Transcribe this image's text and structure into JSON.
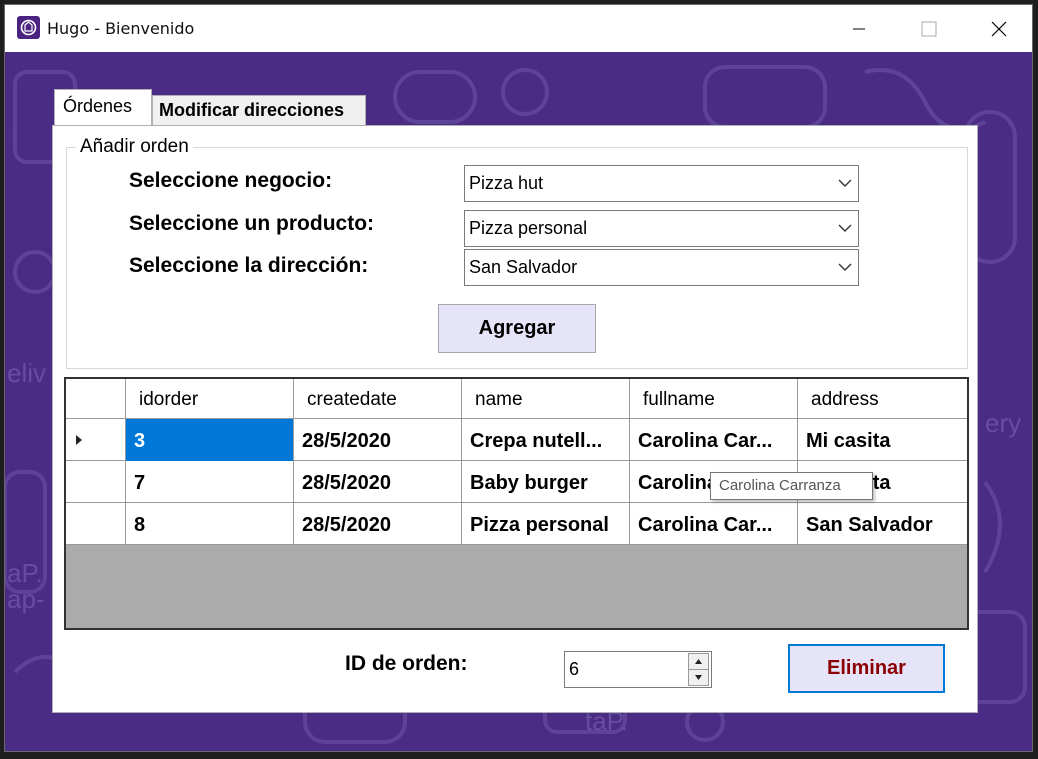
{
  "window": {
    "title": "Hugo - Bienvenido"
  },
  "tabs": [
    {
      "label": "Órdenes",
      "active": true
    },
    {
      "label": "Modificar direcciones",
      "active": false
    }
  ],
  "add_order": {
    "group_label": "Añadir orden",
    "business_label": "Seleccione negocio:",
    "business_value": "Pizza hut",
    "product_label": "Seleccione un producto:",
    "product_value": "Pizza personal",
    "address_label": "Seleccione la dirección:",
    "address_value": "San Salvador",
    "add_button": "Agregar"
  },
  "grid": {
    "columns": [
      "idorder",
      "createdate",
      "name",
      "fullname",
      "address"
    ],
    "rows": [
      [
        "3",
        "28/5/2020",
        "Crepa nutell...",
        "Carolina Car...",
        "Mi casita"
      ],
      [
        "7",
        "28/5/2020",
        "Baby burger",
        "Carolina Car...",
        "Mi casita"
      ],
      [
        "8",
        "28/5/2020",
        "Pizza personal",
        "Carolina Car...",
        "San Salvador"
      ]
    ],
    "tooltip": "Carolina Carranza"
  },
  "delete": {
    "id_label": "ID de orden:",
    "id_value": "6",
    "delete_button": "Eliminar"
  },
  "colors": {
    "background_purple": "#4a2c86",
    "selection_blue": "#0078d7",
    "button_fill": "#e6e4f8",
    "delete_text": "#8b0000"
  }
}
